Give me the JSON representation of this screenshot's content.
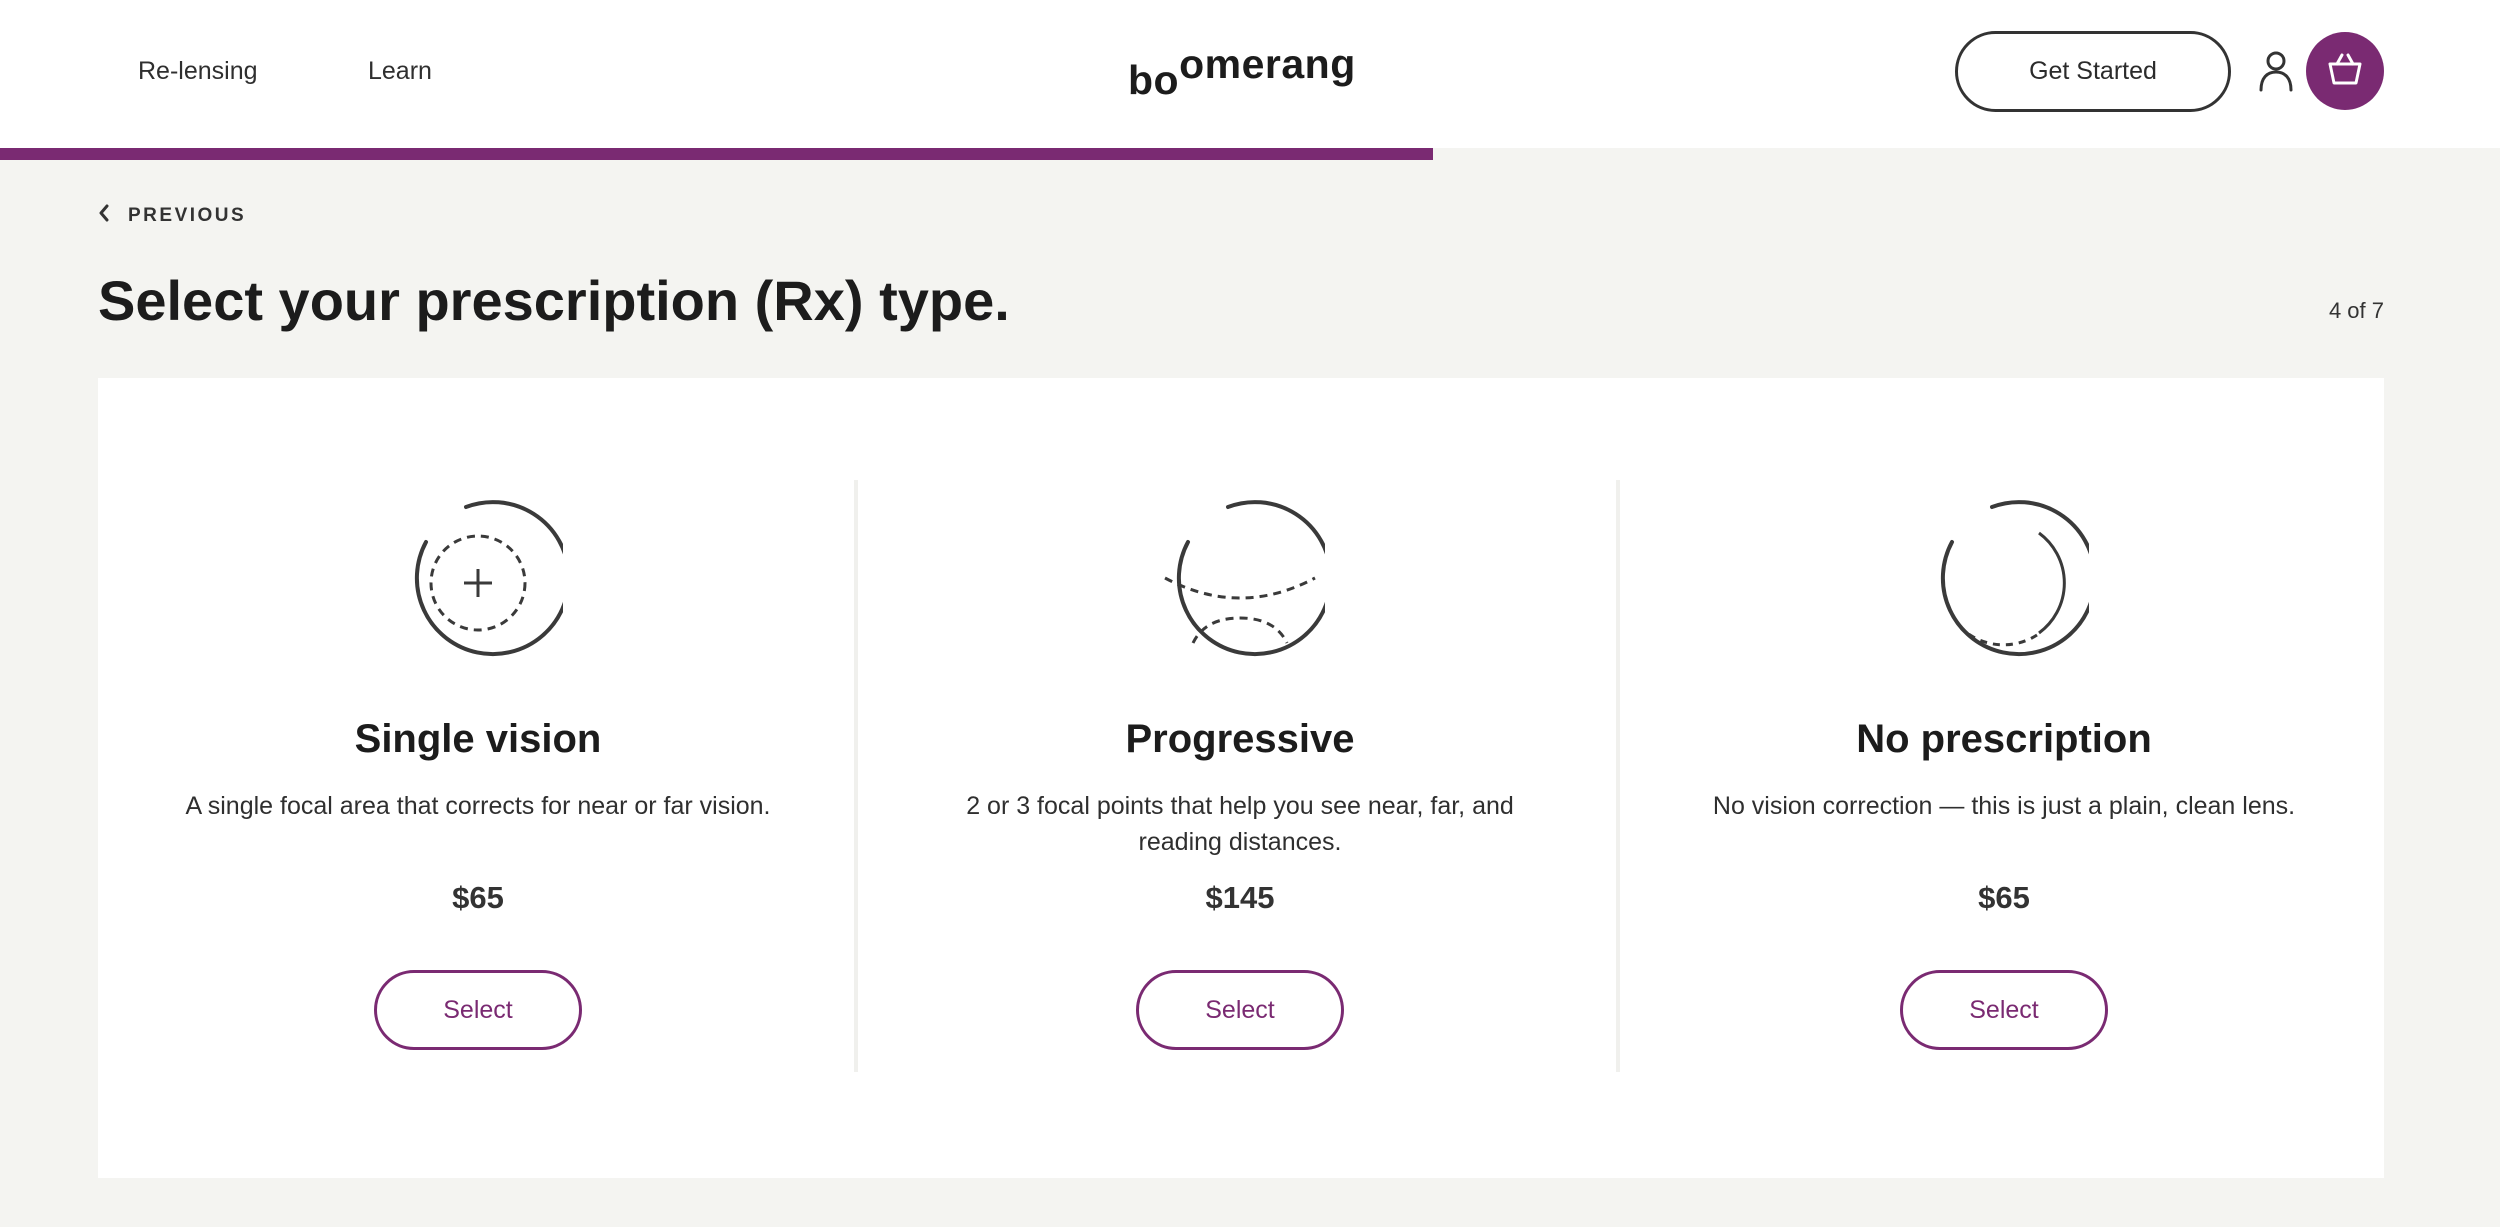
{
  "header": {
    "nav": [
      {
        "label": "Re-lensing"
      },
      {
        "label": "Learn"
      }
    ],
    "logo_text": "boomerang",
    "logo_parts": {
      "lower": "bo",
      "upper": "omerang"
    },
    "get_started_label": "Get Started",
    "account_icon": "user-icon",
    "cart_icon": "basket-icon"
  },
  "progress": {
    "fraction": 0.573
  },
  "colors": {
    "accent": "#7a2a72",
    "background": "#f4f4f1",
    "text": "#1c1c1c"
  },
  "previous_label": "PREVIOUS",
  "page_title": "Select your prescription (Rx) type.",
  "step_count": "4 of 7",
  "options": [
    {
      "icon": "single-vision-lens-icon",
      "name": "Single vision",
      "description": "A single focal area that corrects for near or far vision.",
      "price": "$65",
      "button_label": "Select"
    },
    {
      "icon": "progressive-lens-icon",
      "name": "Progressive",
      "description": "2 or 3 focal points that help you see near, far, and reading distances.",
      "price": "$145",
      "button_label": "Select"
    },
    {
      "icon": "no-prescription-lens-icon",
      "name": "No prescription",
      "description": "No vision correction — this is just a plain, clean lens.",
      "price": "$65",
      "button_label": "Select"
    }
  ]
}
